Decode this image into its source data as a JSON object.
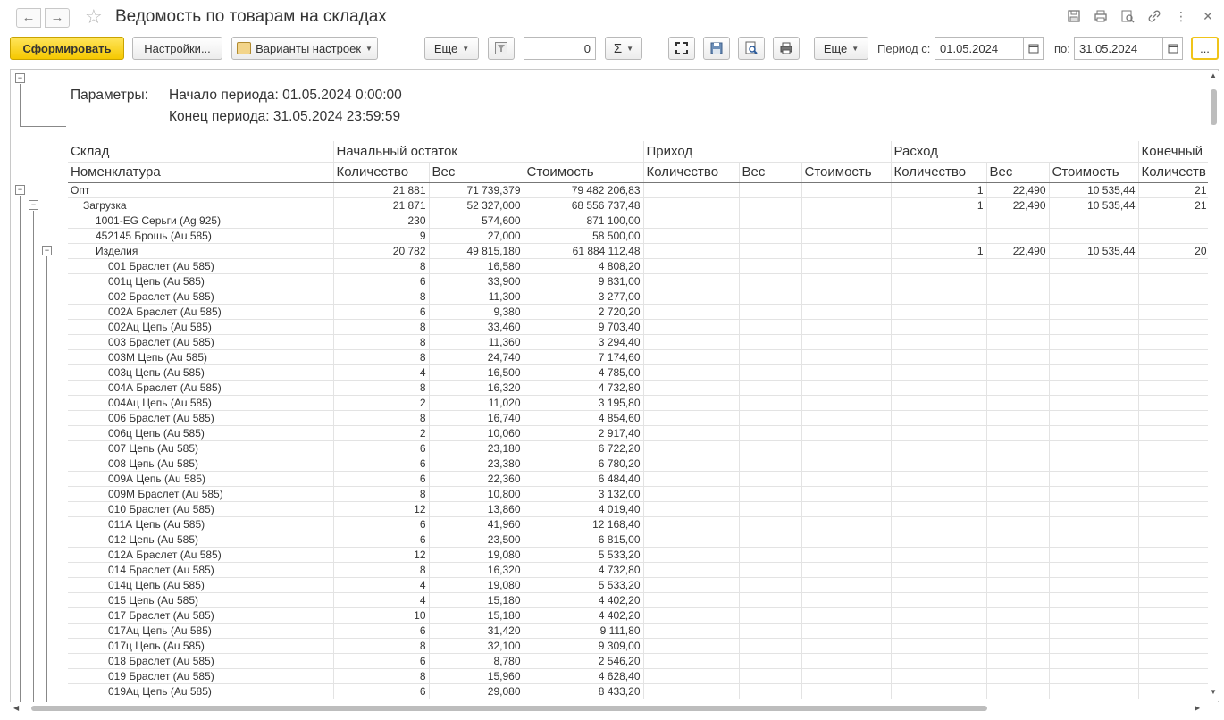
{
  "window": {
    "title": "Ведомость по товарам на складах"
  },
  "icons": [
    "back-arrow",
    "forward-arrow",
    "favorite-star",
    "save-icon",
    "print-icon",
    "preview-icon",
    "link-icon",
    "more-vertical-icon",
    "close-icon"
  ],
  "toolbar": {
    "generate_label": "Сформировать",
    "settings_label": "Настройки...",
    "variants_label": "Варианты настроек",
    "more_label": "Еще",
    "count_value": "0",
    "sum_symbol": "Σ",
    "more2_label": "Еще",
    "period_from_label": "Период с:",
    "period_from_value": "01.05.2024",
    "period_to_label": "по:",
    "period_to_value": "31.05.2024",
    "ellipsis_label": "..."
  },
  "params": {
    "label": "Параметры:",
    "start": "Начало периода: 01.05.2024 0:00:00",
    "end": "Конец периода: 31.05.2024 23:59:59"
  },
  "header": {
    "row1": [
      "Склад",
      "Начальный остаток",
      "Приход",
      "Расход",
      "Конечный"
    ],
    "row2": [
      "Номенклатура",
      "Количество",
      "Вес",
      "Стоимость",
      "Количество",
      "Вес",
      "Стоимость",
      "Количество",
      "Вес",
      "Стоимость",
      "Количеств"
    ]
  },
  "rows": [
    {
      "name": "Опт",
      "level": 0,
      "qty": "21 881",
      "weight": "71 739,379",
      "cost": "79 482 206,83",
      "out_qty": "1",
      "out_weight": "22,490",
      "out_cost": "10 535,44",
      "end_qty": "21"
    },
    {
      "name": "Загрузка",
      "level": 1,
      "qty": "21 871",
      "weight": "52 327,000",
      "cost": "68 556 737,48",
      "out_qty": "1",
      "out_weight": "22,490",
      "out_cost": "10 535,44",
      "end_qty": "21"
    },
    {
      "name": "1001-EG Серьги (Ag 925)",
      "level": 2,
      "qty": "230",
      "weight": "574,600",
      "cost": "871 100,00"
    },
    {
      "name": "452145 Брошь (Au 585)",
      "level": 2,
      "qty": "9",
      "weight": "27,000",
      "cost": "58 500,00"
    },
    {
      "name": "Изделия",
      "level": 2,
      "qty": "20 782",
      "weight": "49 815,180",
      "cost": "61 884 112,48",
      "out_qty": "1",
      "out_weight": "22,490",
      "out_cost": "10 535,44",
      "end_qty": "20"
    },
    {
      "name": "001 Браслет (Au 585)",
      "level": 3,
      "qty": "8",
      "weight": "16,580",
      "cost": "4 808,20"
    },
    {
      "name": "001ц Цепь (Au 585)",
      "level": 3,
      "qty": "6",
      "weight": "33,900",
      "cost": "9 831,00"
    },
    {
      "name": "002 Браслет (Au 585)",
      "level": 3,
      "qty": "8",
      "weight": "11,300",
      "cost": "3 277,00"
    },
    {
      "name": "002А Браслет (Au 585)",
      "level": 3,
      "qty": "6",
      "weight": "9,380",
      "cost": "2 720,20"
    },
    {
      "name": "002Ац Цепь (Au 585)",
      "level": 3,
      "qty": "8",
      "weight": "33,460",
      "cost": "9 703,40"
    },
    {
      "name": "003 Браслет (Au 585)",
      "level": 3,
      "qty": "8",
      "weight": "11,360",
      "cost": "3 294,40"
    },
    {
      "name": "003М Цепь (Au 585)",
      "level": 3,
      "qty": "8",
      "weight": "24,740",
      "cost": "7 174,60"
    },
    {
      "name": "003ц Цепь (Au 585)",
      "level": 3,
      "qty": "4",
      "weight": "16,500",
      "cost": "4 785,00"
    },
    {
      "name": "004А Браслет (Au 585)",
      "level": 3,
      "qty": "8",
      "weight": "16,320",
      "cost": "4 732,80"
    },
    {
      "name": "004Ац Цепь (Au 585)",
      "level": 3,
      "qty": "2",
      "weight": "11,020",
      "cost": "3 195,80"
    },
    {
      "name": "006 Браслет (Au 585)",
      "level": 3,
      "qty": "8",
      "weight": "16,740",
      "cost": "4 854,60"
    },
    {
      "name": "006ц Цепь (Au 585)",
      "level": 3,
      "qty": "2",
      "weight": "10,060",
      "cost": "2 917,40"
    },
    {
      "name": "007 Цепь (Au 585)",
      "level": 3,
      "qty": "6",
      "weight": "23,180",
      "cost": "6 722,20"
    },
    {
      "name": "008 Цепь (Au 585)",
      "level": 3,
      "qty": "6",
      "weight": "23,380",
      "cost": "6 780,20"
    },
    {
      "name": "009А Цепь (Au 585)",
      "level": 3,
      "qty": "6",
      "weight": "22,360",
      "cost": "6 484,40"
    },
    {
      "name": "009М Браслет (Au 585)",
      "level": 3,
      "qty": "8",
      "weight": "10,800",
      "cost": "3 132,00"
    },
    {
      "name": "010 Браслет (Au 585)",
      "level": 3,
      "qty": "12",
      "weight": "13,860",
      "cost": "4 019,40"
    },
    {
      "name": "011А Цепь (Au 585)",
      "level": 3,
      "qty": "6",
      "weight": "41,960",
      "cost": "12 168,40"
    },
    {
      "name": "012 Цепь (Au 585)",
      "level": 3,
      "qty": "6",
      "weight": "23,500",
      "cost": "6 815,00"
    },
    {
      "name": "012А Браслет (Au 585)",
      "level": 3,
      "qty": "12",
      "weight": "19,080",
      "cost": "5 533,20"
    },
    {
      "name": "014 Браслет (Au 585)",
      "level": 3,
      "qty": "8",
      "weight": "16,320",
      "cost": "4 732,80"
    },
    {
      "name": "014ц Цепь (Au 585)",
      "level": 3,
      "qty": "4",
      "weight": "19,080",
      "cost": "5 533,20"
    },
    {
      "name": "015 Цепь (Au 585)",
      "level": 3,
      "qty": "4",
      "weight": "15,180",
      "cost": "4 402,20"
    },
    {
      "name": "017 Браслет (Au 585)",
      "level": 3,
      "qty": "10",
      "weight": "15,180",
      "cost": "4 402,20"
    },
    {
      "name": "017Ац Цепь (Au 585)",
      "level": 3,
      "qty": "6",
      "weight": "31,420",
      "cost": "9 111,80"
    },
    {
      "name": "017ц Цепь (Au 585)",
      "level": 3,
      "qty": "8",
      "weight": "32,100",
      "cost": "9 309,00"
    },
    {
      "name": "018 Браслет (Au 585)",
      "level": 3,
      "qty": "6",
      "weight": "8,780",
      "cost": "2 546,20"
    },
    {
      "name": "019 Браслет (Au 585)",
      "level": 3,
      "qty": "8",
      "weight": "15,960",
      "cost": "4 628,40"
    },
    {
      "name": "019Ац Цепь (Au 585)",
      "level": 3,
      "qty": "6",
      "weight": "29,080",
      "cost": "8 433,20"
    }
  ]
}
